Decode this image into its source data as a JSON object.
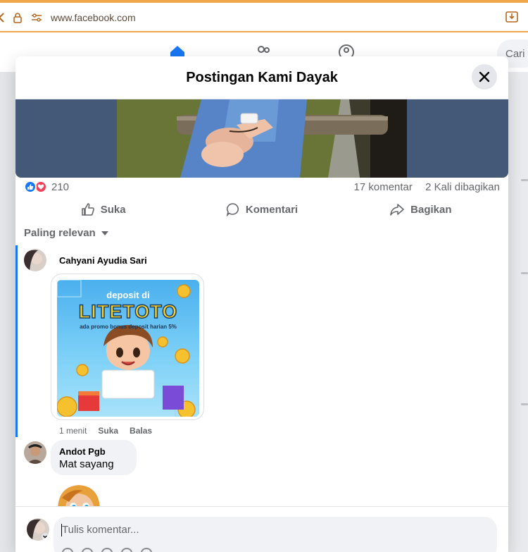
{
  "browser": {
    "url": "www.facebook.com"
  },
  "nav": {
    "search_label": "Cari"
  },
  "modal": {
    "title": "Postingan Kami Dayak"
  },
  "post": {
    "reaction_count": "210",
    "comments_count": "17 komentar",
    "shares_count": "2 Kali dibagikan",
    "actions": {
      "like": "Suka",
      "comment": "Komentari",
      "share": "Bagikan"
    },
    "sort_label": "Paling relevan"
  },
  "comments": [
    {
      "author": "Cahyani Ayudia Sari",
      "ad": {
        "line1": "deposit di",
        "line2": "LITETOTO",
        "line3": "ada promo bonus deposit harian 5%"
      },
      "time": "1 menit",
      "like": "Suka",
      "reply": "Balas"
    },
    {
      "author": "Andot Pgb",
      "text": "Mat sayang"
    }
  ],
  "composer": {
    "placeholder": "Tulis komentar..."
  },
  "colors": {
    "accent": "#1877f2",
    "browser_border": "#f0a64a",
    "photo_band": "#445877"
  }
}
